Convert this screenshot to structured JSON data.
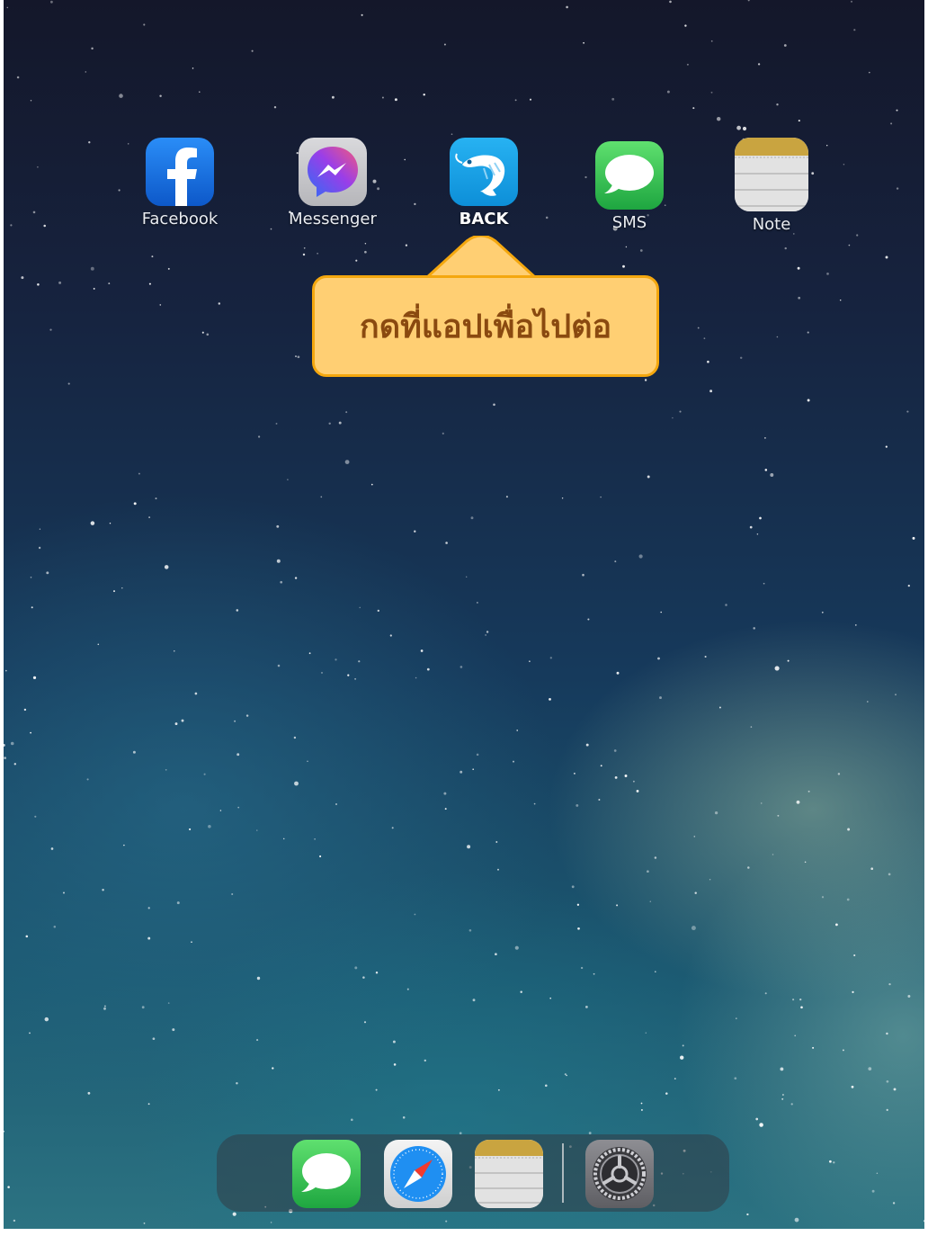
{
  "home_screen": {
    "apps": [
      {
        "label": "Facebook",
        "icon": "facebook-icon"
      },
      {
        "label": "Messenger",
        "icon": "messenger-icon"
      },
      {
        "label": "BACK",
        "icon": "shrimp-app-icon"
      },
      {
        "label": "SMS",
        "icon": "messages-icon"
      },
      {
        "label": "Note",
        "icon": "notes-icon"
      }
    ]
  },
  "tooltip": {
    "text": "กดที่แอปเพื่อไปต่อ",
    "background_color": "#ffcf73",
    "border_color": "#f4a70e",
    "text_color": "#8a4a10"
  },
  "dock": {
    "icons": [
      "messages-icon",
      "safari-icon",
      "notes-icon",
      "settings-icon"
    ]
  },
  "colors": {
    "facebook_blue": "#1877f2",
    "messages_green": "#34c759",
    "back_app_blue": "#1aa3e8",
    "notes_yellow": "#c9a440"
  }
}
